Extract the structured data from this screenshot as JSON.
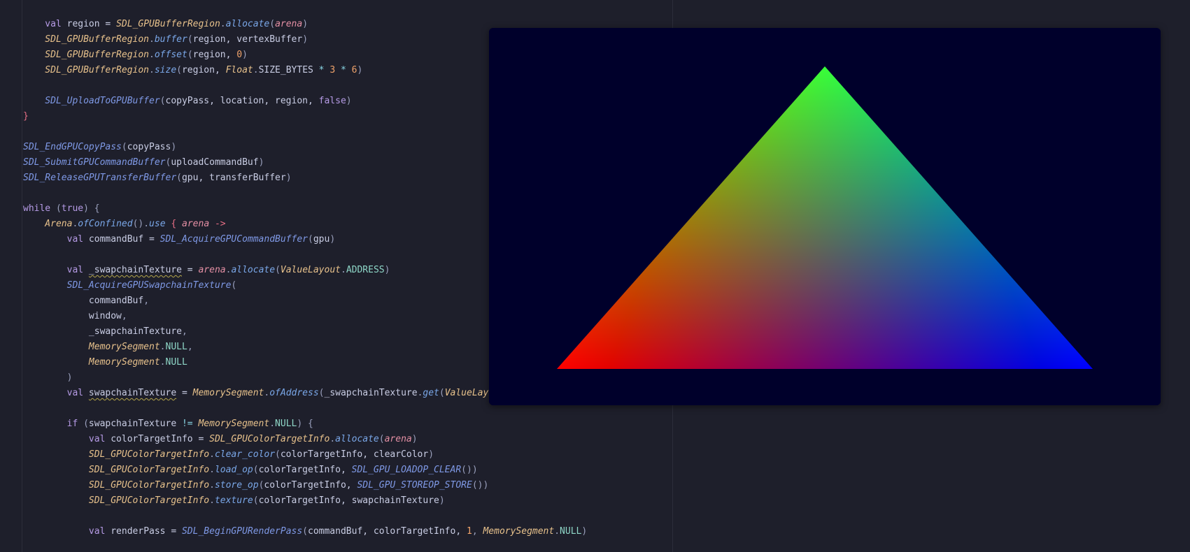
{
  "editor": {
    "lines": [
      [
        [
          "kw",
          "    val "
        ],
        [
          "var",
          "region = "
        ],
        [
          "cls",
          "SDL_GPUBufferRegion"
        ],
        [
          "punc",
          "."
        ],
        [
          "mth",
          "allocate"
        ],
        [
          "punc",
          "("
        ],
        [
          "param",
          "arena"
        ],
        [
          "punc",
          ")"
        ]
      ],
      [
        [
          "cls",
          "    SDL_GPUBufferRegion"
        ],
        [
          "punc",
          "."
        ],
        [
          "mth",
          "buffer"
        ],
        [
          "punc",
          "("
        ],
        [
          "var",
          "region, vertexBuffer"
        ],
        [
          "punc",
          ")"
        ]
      ],
      [
        [
          "cls",
          "    SDL_GPUBufferRegion"
        ],
        [
          "punc",
          "."
        ],
        [
          "mth",
          "offset"
        ],
        [
          "punc",
          "("
        ],
        [
          "var",
          "region, "
        ],
        [
          "num",
          "0"
        ],
        [
          "punc",
          ")"
        ]
      ],
      [
        [
          "cls",
          "    SDL_GPUBufferRegion"
        ],
        [
          "punc",
          "."
        ],
        [
          "mth",
          "size"
        ],
        [
          "punc",
          "("
        ],
        [
          "var",
          "region, "
        ],
        [
          "cls",
          "Float"
        ],
        [
          "punc",
          "."
        ],
        [
          "var",
          "SIZE_BYTES "
        ],
        [
          "op",
          "* "
        ],
        [
          "num",
          "3 "
        ],
        [
          "op",
          "* "
        ],
        [
          "num",
          "6"
        ],
        [
          "punc",
          ")"
        ]
      ],
      [],
      [
        [
          "fn",
          "    SDL_UploadToGPUBuffer"
        ],
        [
          "punc",
          "("
        ],
        [
          "var",
          "copyPass, location, region, "
        ],
        [
          "kw",
          "false"
        ],
        [
          "punc",
          ")"
        ]
      ],
      [
        [
          "brace",
          "}"
        ]
      ],
      [],
      [
        [
          "fn",
          "SDL_EndGPUCopyPass"
        ],
        [
          "punc",
          "("
        ],
        [
          "var",
          "copyPass"
        ],
        [
          "punc",
          ")"
        ]
      ],
      [
        [
          "fn",
          "SDL_SubmitGPUCommandBuffer"
        ],
        [
          "punc",
          "("
        ],
        [
          "var",
          "uploadCommandBuf"
        ],
        [
          "punc",
          ")"
        ]
      ],
      [
        [
          "fn",
          "SDL_ReleaseGPUTransferBuffer"
        ],
        [
          "punc",
          "("
        ],
        [
          "var",
          "gpu, transferBuffer"
        ],
        [
          "punc",
          ")"
        ]
      ],
      [],
      [
        [
          "kw",
          "while "
        ],
        [
          "punc",
          "("
        ],
        [
          "kw",
          "true"
        ],
        [
          "punc",
          ") {"
        ]
      ],
      [
        [
          "cls",
          "    Arena"
        ],
        [
          "punc",
          "."
        ],
        [
          "mth",
          "ofConfined"
        ],
        [
          "punc",
          "()."
        ],
        [
          "mth",
          "use "
        ],
        [
          "brace",
          "{ "
        ],
        [
          "param",
          "arena "
        ],
        [
          "brace",
          "->"
        ]
      ],
      [
        [
          "kw",
          "        val "
        ],
        [
          "var",
          "commandBuf = "
        ],
        [
          "fn",
          "SDL_AcquireGPUCommandBuffer"
        ],
        [
          "punc",
          "("
        ],
        [
          "var",
          "gpu"
        ],
        [
          "punc",
          ")"
        ]
      ],
      [],
      [
        [
          "kw",
          "        val "
        ],
        [
          "squig",
          "_swapchainTexture"
        ],
        [
          "var",
          " = "
        ],
        [
          "param",
          "arena"
        ],
        [
          "punc",
          "."
        ],
        [
          "mth",
          "allocate"
        ],
        [
          "punc",
          "("
        ],
        [
          "cls",
          "ValueLayout"
        ],
        [
          "punc",
          "."
        ],
        [
          "const",
          "ADDRESS"
        ],
        [
          "punc",
          ")"
        ]
      ],
      [
        [
          "fn",
          "        SDL_AcquireGPUSwapchainTexture"
        ],
        [
          "punc",
          "("
        ]
      ],
      [
        [
          "var",
          "            commandBuf"
        ],
        [
          "punc",
          ","
        ]
      ],
      [
        [
          "var",
          "            window"
        ],
        [
          "punc",
          ","
        ]
      ],
      [
        [
          "var",
          "            _swapchainTexture"
        ],
        [
          "punc",
          ","
        ]
      ],
      [
        [
          "cls",
          "            MemorySegment"
        ],
        [
          "punc",
          "."
        ],
        [
          "const",
          "NULL"
        ],
        [
          "punc",
          ","
        ]
      ],
      [
        [
          "cls",
          "            MemorySegment"
        ],
        [
          "punc",
          "."
        ],
        [
          "const",
          "NULL"
        ]
      ],
      [
        [
          "punc",
          "        )"
        ]
      ],
      [
        [
          "kw",
          "        val "
        ],
        [
          "squig",
          "swapchainTexture"
        ],
        [
          "var",
          " = "
        ],
        [
          "cls",
          "MemorySegment"
        ],
        [
          "punc",
          "."
        ],
        [
          "mth",
          "ofAddress"
        ],
        [
          "punc",
          "("
        ],
        [
          "var",
          "_swapchainTexture"
        ],
        [
          "punc",
          "."
        ],
        [
          "mth",
          "get"
        ],
        [
          "punc",
          "("
        ],
        [
          "cls",
          "ValueLayout"
        ]
      ],
      [],
      [
        [
          "kw",
          "        if "
        ],
        [
          "punc",
          "("
        ],
        [
          "var",
          "swapchainTexture "
        ],
        [
          "op",
          "!= "
        ],
        [
          "cls",
          "MemorySegment"
        ],
        [
          "punc",
          "."
        ],
        [
          "const",
          "NULL"
        ],
        [
          "punc",
          ") {"
        ]
      ],
      [
        [
          "kw",
          "            val "
        ],
        [
          "var",
          "colorTargetInfo = "
        ],
        [
          "cls",
          "SDL_GPUColorTargetInfo"
        ],
        [
          "punc",
          "."
        ],
        [
          "mth",
          "allocate"
        ],
        [
          "punc",
          "("
        ],
        [
          "param",
          "arena"
        ],
        [
          "punc",
          ")"
        ]
      ],
      [
        [
          "cls",
          "            SDL_GPUColorTargetInfo"
        ],
        [
          "punc",
          "."
        ],
        [
          "mth",
          "clear_color"
        ],
        [
          "punc",
          "("
        ],
        [
          "var",
          "colorTargetInfo, clearColor"
        ],
        [
          "punc",
          ")"
        ]
      ],
      [
        [
          "cls",
          "            SDL_GPUColorTargetInfo"
        ],
        [
          "punc",
          "."
        ],
        [
          "mth",
          "load_op"
        ],
        [
          "punc",
          "("
        ],
        [
          "var",
          "colorTargetInfo, "
        ],
        [
          "fn",
          "SDL_GPU_LOADOP_CLEAR"
        ],
        [
          "punc",
          "())"
        ]
      ],
      [
        [
          "cls",
          "            SDL_GPUColorTargetInfo"
        ],
        [
          "punc",
          "."
        ],
        [
          "mth",
          "store_op"
        ],
        [
          "punc",
          "("
        ],
        [
          "var",
          "colorTargetInfo, "
        ],
        [
          "fn",
          "SDL_GPU_STOREOP_STORE"
        ],
        [
          "punc",
          "())"
        ]
      ],
      [
        [
          "cls",
          "            SDL_GPUColorTargetInfo"
        ],
        [
          "punc",
          "."
        ],
        [
          "mth",
          "texture"
        ],
        [
          "punc",
          "("
        ],
        [
          "var",
          "colorTargetInfo, swapchainTexture"
        ],
        [
          "punc",
          ")"
        ]
      ],
      [],
      [
        [
          "kw",
          "            val "
        ],
        [
          "var",
          "renderPass = "
        ],
        [
          "fn",
          "SDL_BeginGPURenderPass"
        ],
        [
          "punc",
          "("
        ],
        [
          "var",
          "commandBuf, colorTargetInfo, "
        ],
        [
          "num",
          "1"
        ],
        [
          "punc",
          ", "
        ],
        [
          "cls",
          "MemorySegment"
        ],
        [
          "punc",
          "."
        ],
        [
          "const",
          "NULL"
        ],
        [
          "punc",
          ")"
        ]
      ]
    ]
  },
  "render_window": {
    "clear_color": "#00002b",
    "triangle_vertex_colors": [
      "#ff0000",
      "#00ff00",
      "#0000ff"
    ]
  }
}
